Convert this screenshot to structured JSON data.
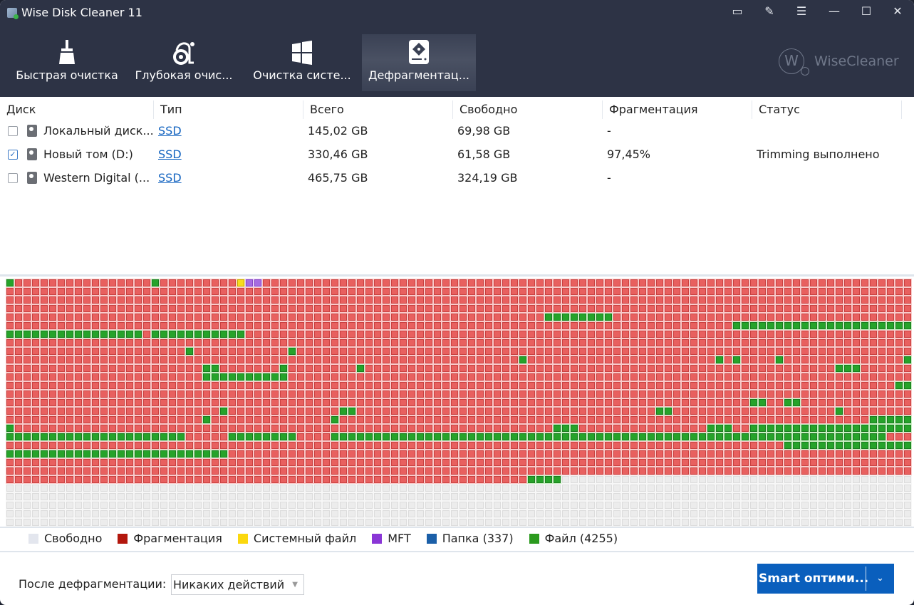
{
  "window": {
    "title": "Wise Disk Cleaner 11",
    "logo_text": "WiseCleaner",
    "logo_mark": "W"
  },
  "window_controls": [
    {
      "name": "feedback-icon",
      "glyph": "▭"
    },
    {
      "name": "notes-icon",
      "glyph": "✎"
    },
    {
      "name": "menu-icon",
      "glyph": "☰"
    },
    {
      "name": "minimize-icon",
      "glyph": "—"
    },
    {
      "name": "maximize-icon",
      "glyph": "☐"
    },
    {
      "name": "close-icon",
      "glyph": "✕"
    }
  ],
  "tabs": [
    {
      "label": "Быстрая очистка",
      "icon": "broom-icon",
      "active": false
    },
    {
      "label": "Глубокая очис...",
      "icon": "vacuum-icon",
      "active": false
    },
    {
      "label": "Очистка систе...",
      "icon": "windows-icon",
      "active": false
    },
    {
      "label": "Дефрагментац...",
      "icon": "disk-icon",
      "active": true
    }
  ],
  "table": {
    "headers": [
      "Диск",
      "Тип",
      "Всего",
      "Свободно",
      "Фрагментация",
      "Статус"
    ],
    "rows": [
      {
        "checked": false,
        "check": "",
        "disk": "Локальный диск...",
        "type": "SSD",
        "total": "145,02 GB",
        "free": "69,98 GB",
        "frag": "-",
        "status": ""
      },
      {
        "checked": true,
        "check": "✓",
        "disk": "Новый том (D:)",
        "type": "SSD",
        "total": "330,46 GB",
        "free": "61,58 GB",
        "frag": "97,45%",
        "status": "Trimming выполнено"
      },
      {
        "checked": false,
        "check": "",
        "disk": "Western Digital (...",
        "type": "SSD",
        "total": "465,75 GB",
        "free": "324,19 GB",
        "frag": "-",
        "status": ""
      }
    ]
  },
  "cluster_map": {
    "columns": 106,
    "rows": 29,
    "default": "frag",
    "free_from": {
      "row": 23,
      "col": 65
    },
    "file_runs": [
      [
        0,
        0,
        0
      ],
      [
        0,
        17,
        17
      ],
      [
        4,
        63,
        70
      ],
      [
        5,
        85,
        105
      ],
      [
        6,
        0,
        15
      ],
      [
        6,
        17,
        27
      ],
      [
        8,
        21,
        21
      ],
      [
        8,
        33,
        33
      ],
      [
        9,
        60,
        60
      ],
      [
        9,
        83,
        83
      ],
      [
        9,
        85,
        85
      ],
      [
        9,
        90,
        90
      ],
      [
        9,
        105,
        105
      ],
      [
        10,
        23,
        24
      ],
      [
        10,
        32,
        32
      ],
      [
        10,
        41,
        41
      ],
      [
        10,
        97,
        99
      ],
      [
        11,
        23,
        32
      ],
      [
        12,
        104,
        105
      ],
      [
        14,
        87,
        88
      ],
      [
        14,
        91,
        92
      ],
      [
        15,
        25,
        25
      ],
      [
        15,
        39,
        40
      ],
      [
        15,
        76,
        77
      ],
      [
        15,
        97,
        97
      ],
      [
        16,
        23,
        23
      ],
      [
        16,
        38,
        38
      ],
      [
        16,
        101,
        105
      ],
      [
        17,
        0,
        0
      ],
      [
        17,
        64,
        66
      ],
      [
        17,
        82,
        84
      ],
      [
        17,
        87,
        105
      ],
      [
        18,
        0,
        20
      ],
      [
        18,
        26,
        33
      ],
      [
        18,
        38,
        102
      ],
      [
        19,
        91,
        105
      ],
      [
        20,
        0,
        25
      ],
      [
        23,
        61,
        64
      ]
    ],
    "system_blocks": [
      [
        0,
        27
      ]
    ],
    "mft_blocks": [
      [
        0,
        28
      ],
      [
        0,
        29
      ]
    ]
  },
  "legend": [
    {
      "label": "Свободно",
      "color": "#e3e6ee"
    },
    {
      "label": "Фрагментация",
      "color": "#b3170d"
    },
    {
      "label": "Системный файл",
      "color": "#fbd80e"
    },
    {
      "label": "MFT",
      "color": "#8a36d6"
    },
    {
      "label": "Папка (337)",
      "color": "#1b5fa8"
    },
    {
      "label": "Файл (4255)",
      "color": "#2b9a1e"
    }
  ],
  "footer": {
    "after_label": "После дефрагментации:",
    "after_value": "Никаких действий",
    "button_label": "Smart оптими...",
    "button_chevron": "⌄"
  }
}
